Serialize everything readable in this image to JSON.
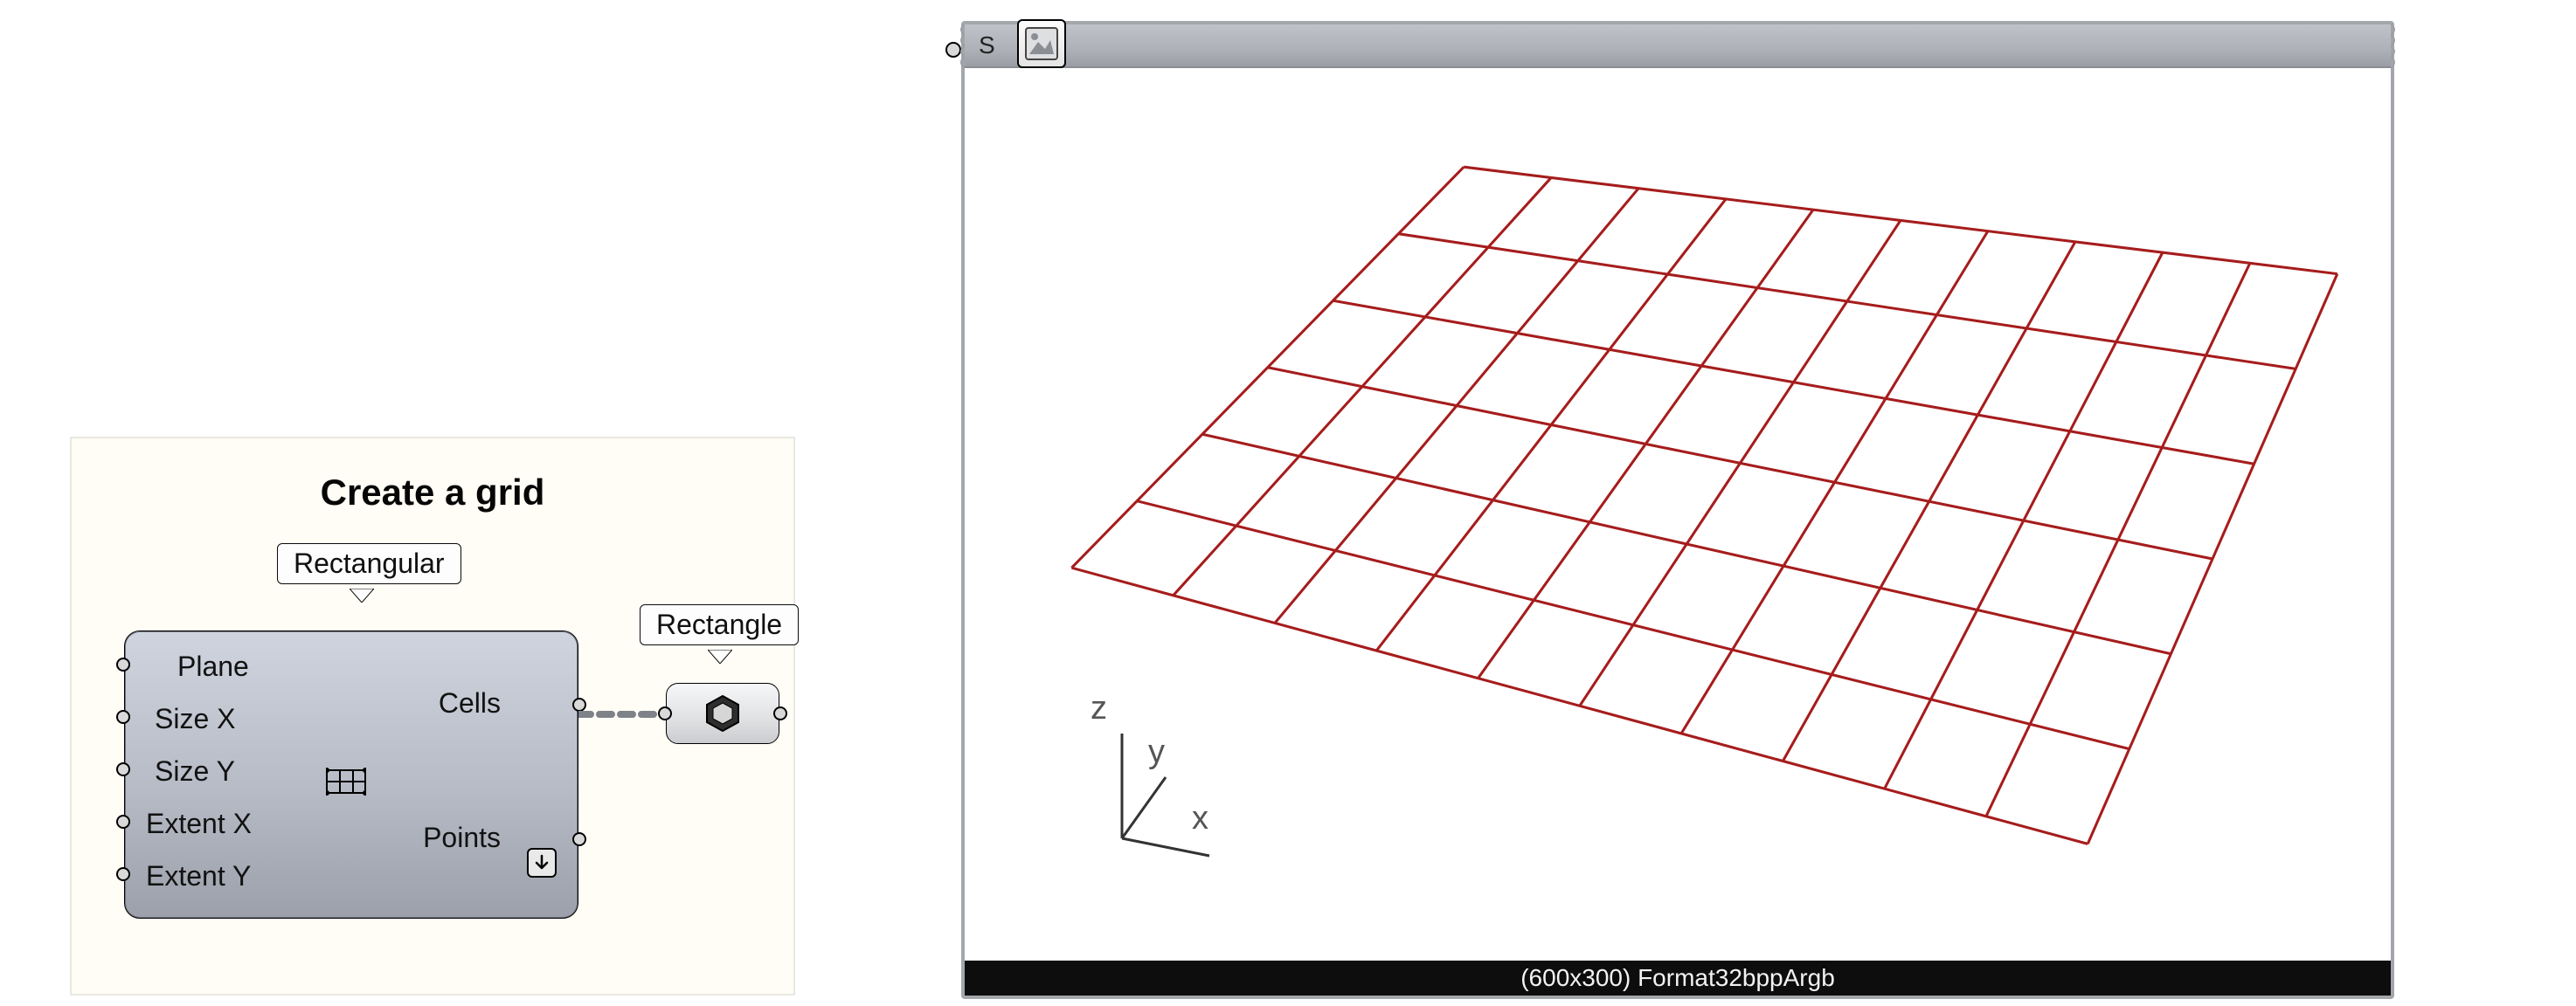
{
  "scribble": {
    "title": "Create a grid"
  },
  "component": {
    "label": "Rectangular",
    "inputs": [
      "Plane",
      "Size X",
      "Size Y",
      "Extent X",
      "Extent Y"
    ],
    "outputs": [
      "Cells",
      "Points"
    ]
  },
  "param": {
    "label": "Rectangle"
  },
  "viewer": {
    "header_char": "S",
    "footer_text": "(600x300) Format32bppArgb",
    "axes": {
      "x": "x",
      "y": "y",
      "z": "z"
    },
    "grid": {
      "cols": 10,
      "rows": 6,
      "color": "#a61c1c"
    }
  }
}
